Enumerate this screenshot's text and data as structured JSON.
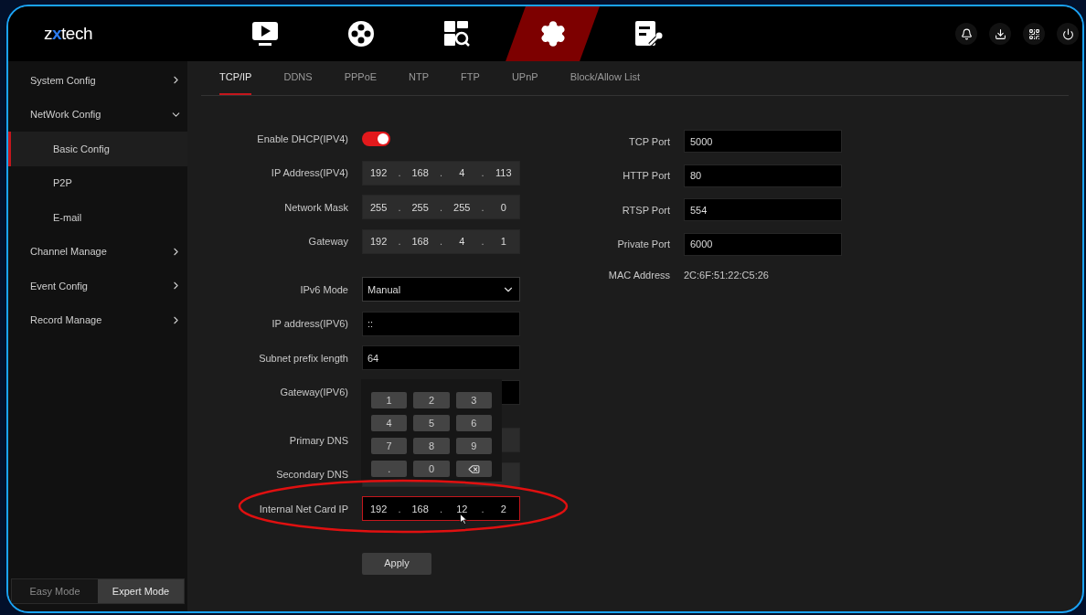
{
  "logo": "zxtech",
  "nav": [
    {
      "kind": "live",
      "selected": false
    },
    {
      "kind": "playback",
      "selected": false
    },
    {
      "kind": "search",
      "selected": false
    },
    {
      "kind": "settings",
      "selected": true
    },
    {
      "kind": "maintenance",
      "selected": false
    }
  ],
  "sidebar": {
    "items": [
      {
        "label": "System Config",
        "expanded": false
      },
      {
        "label": "NetWork Config",
        "expanded": true,
        "children": [
          {
            "label": "Basic Config",
            "selected": true
          },
          {
            "label": "P2P",
            "selected": false
          },
          {
            "label": "E-mail",
            "selected": false
          }
        ]
      },
      {
        "label": "Channel Manage",
        "expanded": false
      },
      {
        "label": "Event Config",
        "expanded": false
      },
      {
        "label": "Record Manage",
        "expanded": false
      }
    ],
    "modes": [
      {
        "label": "Easy Mode",
        "selected": false
      },
      {
        "label": "Expert Mode",
        "selected": true
      }
    ]
  },
  "tabs": [
    {
      "label": "TCP/IP",
      "selected": true
    },
    {
      "label": "DDNS",
      "selected": false
    },
    {
      "label": "PPPoE",
      "selected": false
    },
    {
      "label": "NTP",
      "selected": false
    },
    {
      "label": "FTP",
      "selected": false
    },
    {
      "label": "UPnP",
      "selected": false
    },
    {
      "label": "Block/Allow List",
      "selected": false
    }
  ],
  "form": {
    "sections": [
      [
        {
          "kind": "toggle",
          "label": "Enable DHCP(IPV4)",
          "on": true
        },
        {
          "kind": "ip",
          "label": "IP Address(IPV4)",
          "octets": [
            "192",
            "168",
            "4",
            "113"
          ],
          "separator": ".",
          "disabled": true,
          "focused": false
        },
        {
          "kind": "ip",
          "label": "Network Mask",
          "octets": [
            "255",
            "255",
            "255",
            "0"
          ],
          "separator": ".",
          "disabled": true,
          "focused": false
        },
        {
          "kind": "ip",
          "label": "Gateway",
          "octets": [
            "192",
            "168",
            "4",
            "1"
          ],
          "separator": ".",
          "disabled": true,
          "focused": false
        }
      ],
      [
        {
          "kind": "select",
          "label": "IPv6 Mode",
          "value": "Manual"
        },
        {
          "kind": "text",
          "label": "IP address(IPV6)",
          "value": "::",
          "disabled": false
        },
        {
          "kind": "text",
          "label": "Subnet prefix length",
          "value": "64",
          "disabled": false
        },
        {
          "kind": "text",
          "label": "Gateway(IPV6)",
          "disabled": false
        }
      ],
      [
        {
          "kind": "text",
          "label": "Primary DNS",
          "disabled": true
        },
        {
          "kind": "text",
          "label": "Secondary DNS",
          "disabled": true
        },
        {
          "kind": "ip",
          "label": "Internal Net Card IP",
          "octets": [
            "192",
            "168",
            "12",
            "2"
          ],
          "separator": ".",
          "disabled": false,
          "focused": true
        }
      ]
    ],
    "apply": "Apply"
  },
  "ports": [
    {
      "label": "TCP Port",
      "value": "5000"
    },
    {
      "label": "HTTP Port",
      "value": "80"
    },
    {
      "label": "RTSP Port",
      "value": "554"
    },
    {
      "label": "Private Port",
      "value": "6000"
    }
  ],
  "mac": {
    "label": "MAC Address",
    "value": "2C:6F:51:22:C5:26"
  },
  "keypad": [
    {
      "kind": "digit",
      "label": "1"
    },
    {
      "kind": "digit",
      "label": "2"
    },
    {
      "kind": "digit",
      "label": "3"
    },
    {
      "kind": "digit",
      "label": "4"
    },
    {
      "kind": "digit",
      "label": "5"
    },
    {
      "kind": "digit",
      "label": "6"
    },
    {
      "kind": "digit",
      "label": "7"
    },
    {
      "kind": "digit",
      "label": "8"
    },
    {
      "kind": "digit",
      "label": "9"
    },
    {
      "kind": "digit",
      "label": "."
    },
    {
      "kind": "digit",
      "label": "0"
    },
    {
      "kind": "backspace"
    }
  ]
}
